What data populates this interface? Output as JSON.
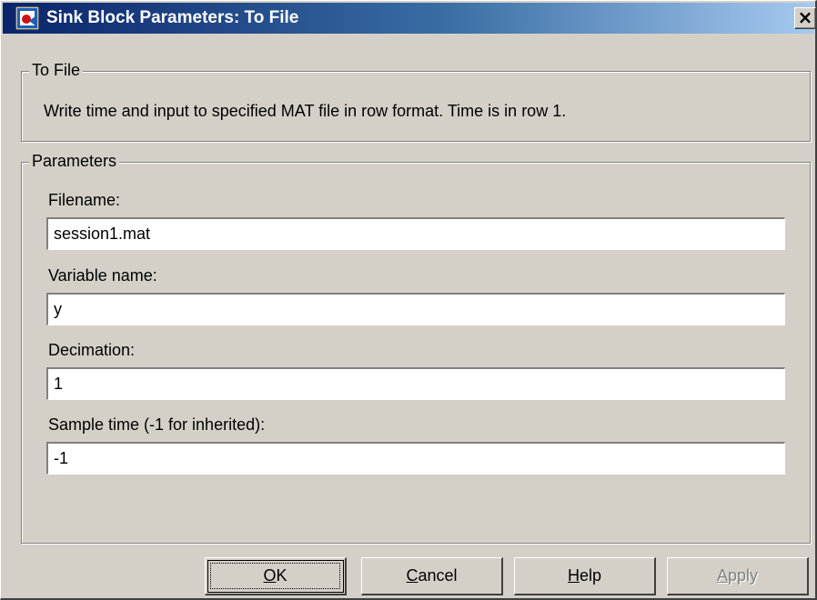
{
  "window": {
    "title": "Sink Block Parameters: To File",
    "close_label": "×"
  },
  "block_info": {
    "group_label": "To File",
    "description": "Write time and input to specified MAT file in row format.  Time is in row 1."
  },
  "parameters": {
    "group_label": "Parameters",
    "fields": [
      {
        "label": "Filename:",
        "value": "session1.mat"
      },
      {
        "label": "Variable name:",
        "value": "y"
      },
      {
        "label": "Decimation:",
        "value": "1"
      },
      {
        "label": "Sample time (-1 for inherited):",
        "value": "-1"
      }
    ]
  },
  "buttons": {
    "ok": {
      "mnemonic": "O",
      "rest": "K"
    },
    "cancel": {
      "mnemonic": "C",
      "rest": "ancel"
    },
    "help": {
      "mnemonic": "H",
      "rest": "elp"
    },
    "apply": {
      "mnemonic": "A",
      "rest": "pply",
      "enabled": false
    }
  },
  "colors": {
    "title_bar_start": "#0a246a",
    "title_bar_end": "#a6caf0",
    "face": "#d4d0c8"
  }
}
